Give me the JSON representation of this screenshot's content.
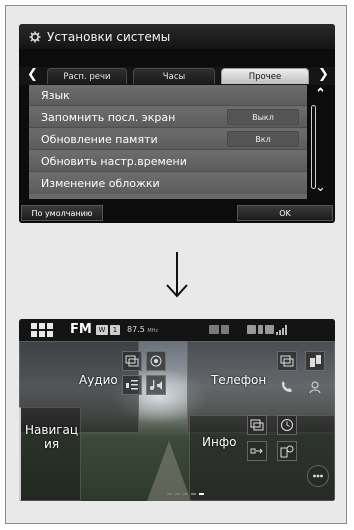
{
  "settings_screen": {
    "title": "Установки системы",
    "tabs": [
      {
        "label": "Расп. речи"
      },
      {
        "label": "Часы"
      },
      {
        "label": "Прочее"
      }
    ],
    "rows": [
      {
        "label": "Язык",
        "value": ""
      },
      {
        "label": "Запомнить посл. экран",
        "value": "Выкл"
      },
      {
        "label": "Обновление памяти",
        "value": "Вкл"
      },
      {
        "label": "Обновить настр.времени",
        "value": ""
      },
      {
        "label": "Изменение обложки",
        "value": ""
      }
    ],
    "default_button": "По умолчанию",
    "ok_button": "OK"
  },
  "home_screen": {
    "source": "FM",
    "badge_1": "W",
    "badge_2": "1",
    "frequency": "87.5",
    "frequency_unit": "MHz",
    "tiles": {
      "audio": "Аудио",
      "phone": "Телефон",
      "navigation": "Навигац\nия",
      "info": "Инфо"
    }
  },
  "colors": {
    "frame_border": "#8c8c8c",
    "frame_background": "#e9e9e9",
    "screen_background": "#0c0c0c",
    "active_tab": "#e0e0e0",
    "list_row": "#666666"
  }
}
